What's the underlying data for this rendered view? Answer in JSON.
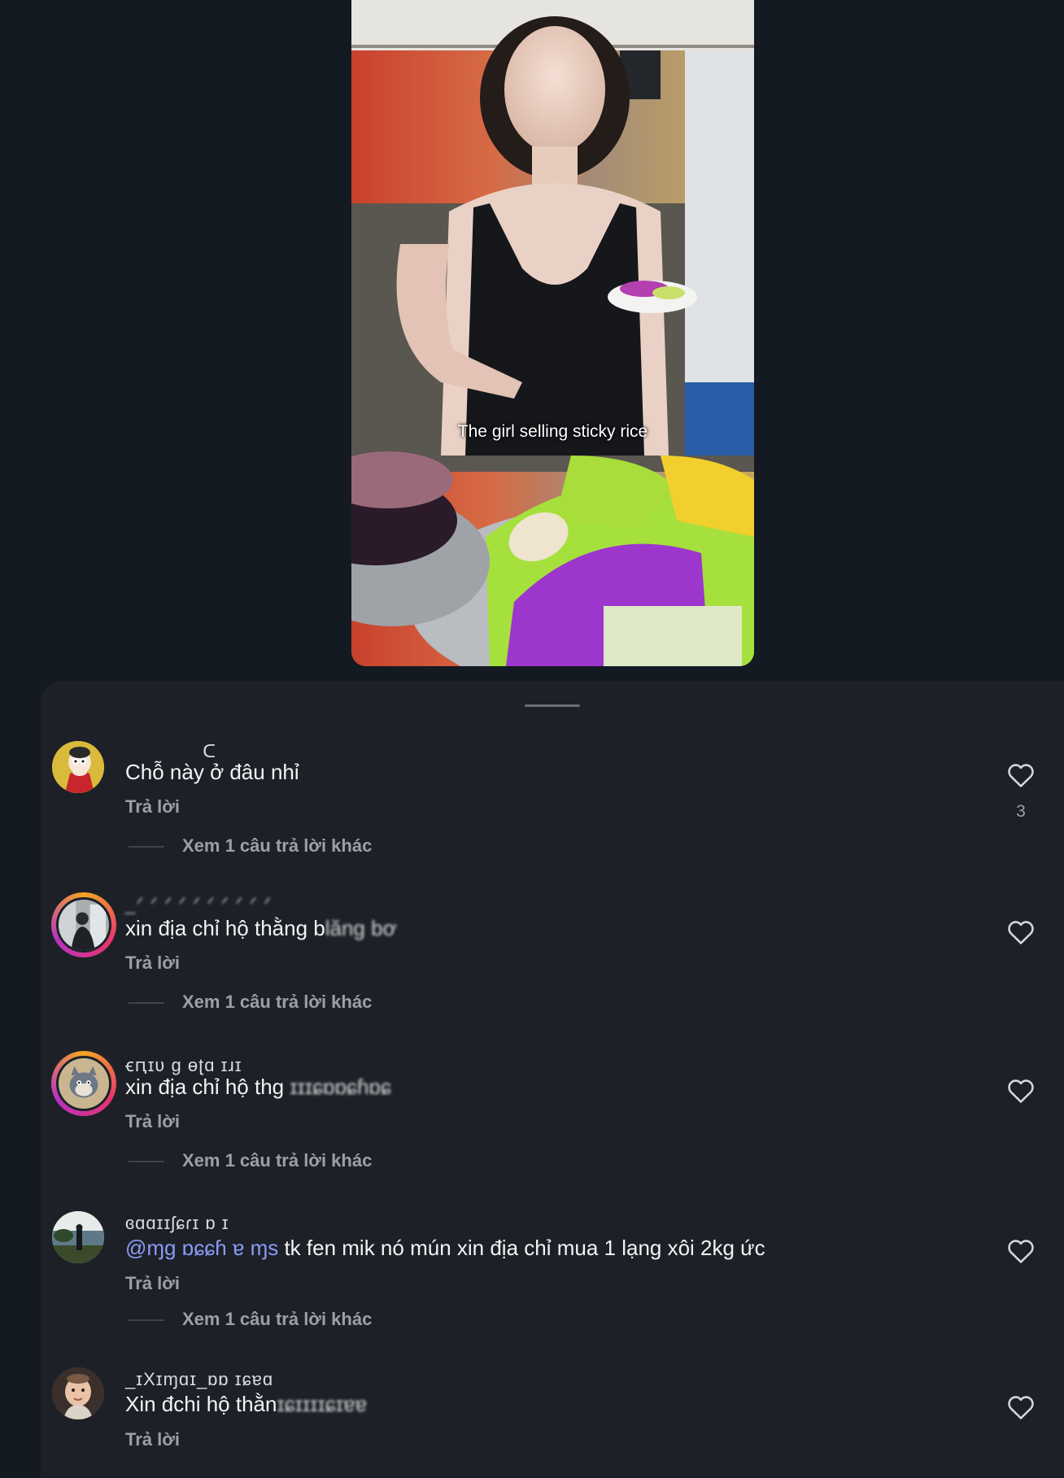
{
  "video": {
    "caption": "The girl selling sticky rice"
  },
  "comments": [
    {
      "username": "ㅤㅤㅤ ㅤ ᑕ",
      "text": "Chỗ này ở đâu nhỉ",
      "reply_label": "Trả lời",
      "more_replies": "Xem 1 câu trả lời khác",
      "like_count": "3",
      "avatar": "cartoon-avatar"
    },
    {
      "username": "_ᐟ ᐟ ᐟ ᐟ ᐟ ᐟ ᐟ ᐟ ᐟ ᐟ ",
      "text_prefix": "xin địa chỉ hộ thằng b",
      "text_obscured": "lăng bơ",
      "reply_label": "Trả lời",
      "more_replies": "Xem 1 câu trả lời khác",
      "avatar": "photo-avatar-ring"
    },
    {
      "username": "ꞓԥɪʋ ɡ ɵʈɑ ɪɹɪ",
      "text_prefix": "xin địa chỉ hộ thg ",
      "text_obscured": "ɪɪɪɕɒɒɕɦɒɕ",
      "reply_label": "Trả lời",
      "more_replies": "Xem 1 câu trả lời khác",
      "avatar": "cat-avatar-ring"
    },
    {
      "username": "ɞɑɑɪɪʃɕɾɪ ɒ ɪ",
      "mention": "@ɱɡ ɒɕɕɦ ɐ ɱs",
      "text": " tk fen mik nó mún xin địa chỉ mua 1 lạng xôi 2kg ức",
      "reply_label": "Trả lời",
      "more_replies": "Xem 1 câu trả lời khác",
      "avatar": "beach-avatar"
    },
    {
      "username": "_ɪXɪɱɑɪ_ɒɒ ɪɕɐɑ",
      "text_prefix": "Xin đchi hộ thằn",
      "text_obscured": "ɪɕɪɪɪɪɕɪɐɐ",
      "reply_label": "Trả lời",
      "avatar": "baby-avatar"
    }
  ],
  "icons": {
    "like": "heart-outline-icon"
  },
  "colors": {
    "background": "#141a22",
    "sheet": "#1d2127",
    "mention": "#8a9bf5",
    "secondary_text": "#9ba0a8"
  }
}
